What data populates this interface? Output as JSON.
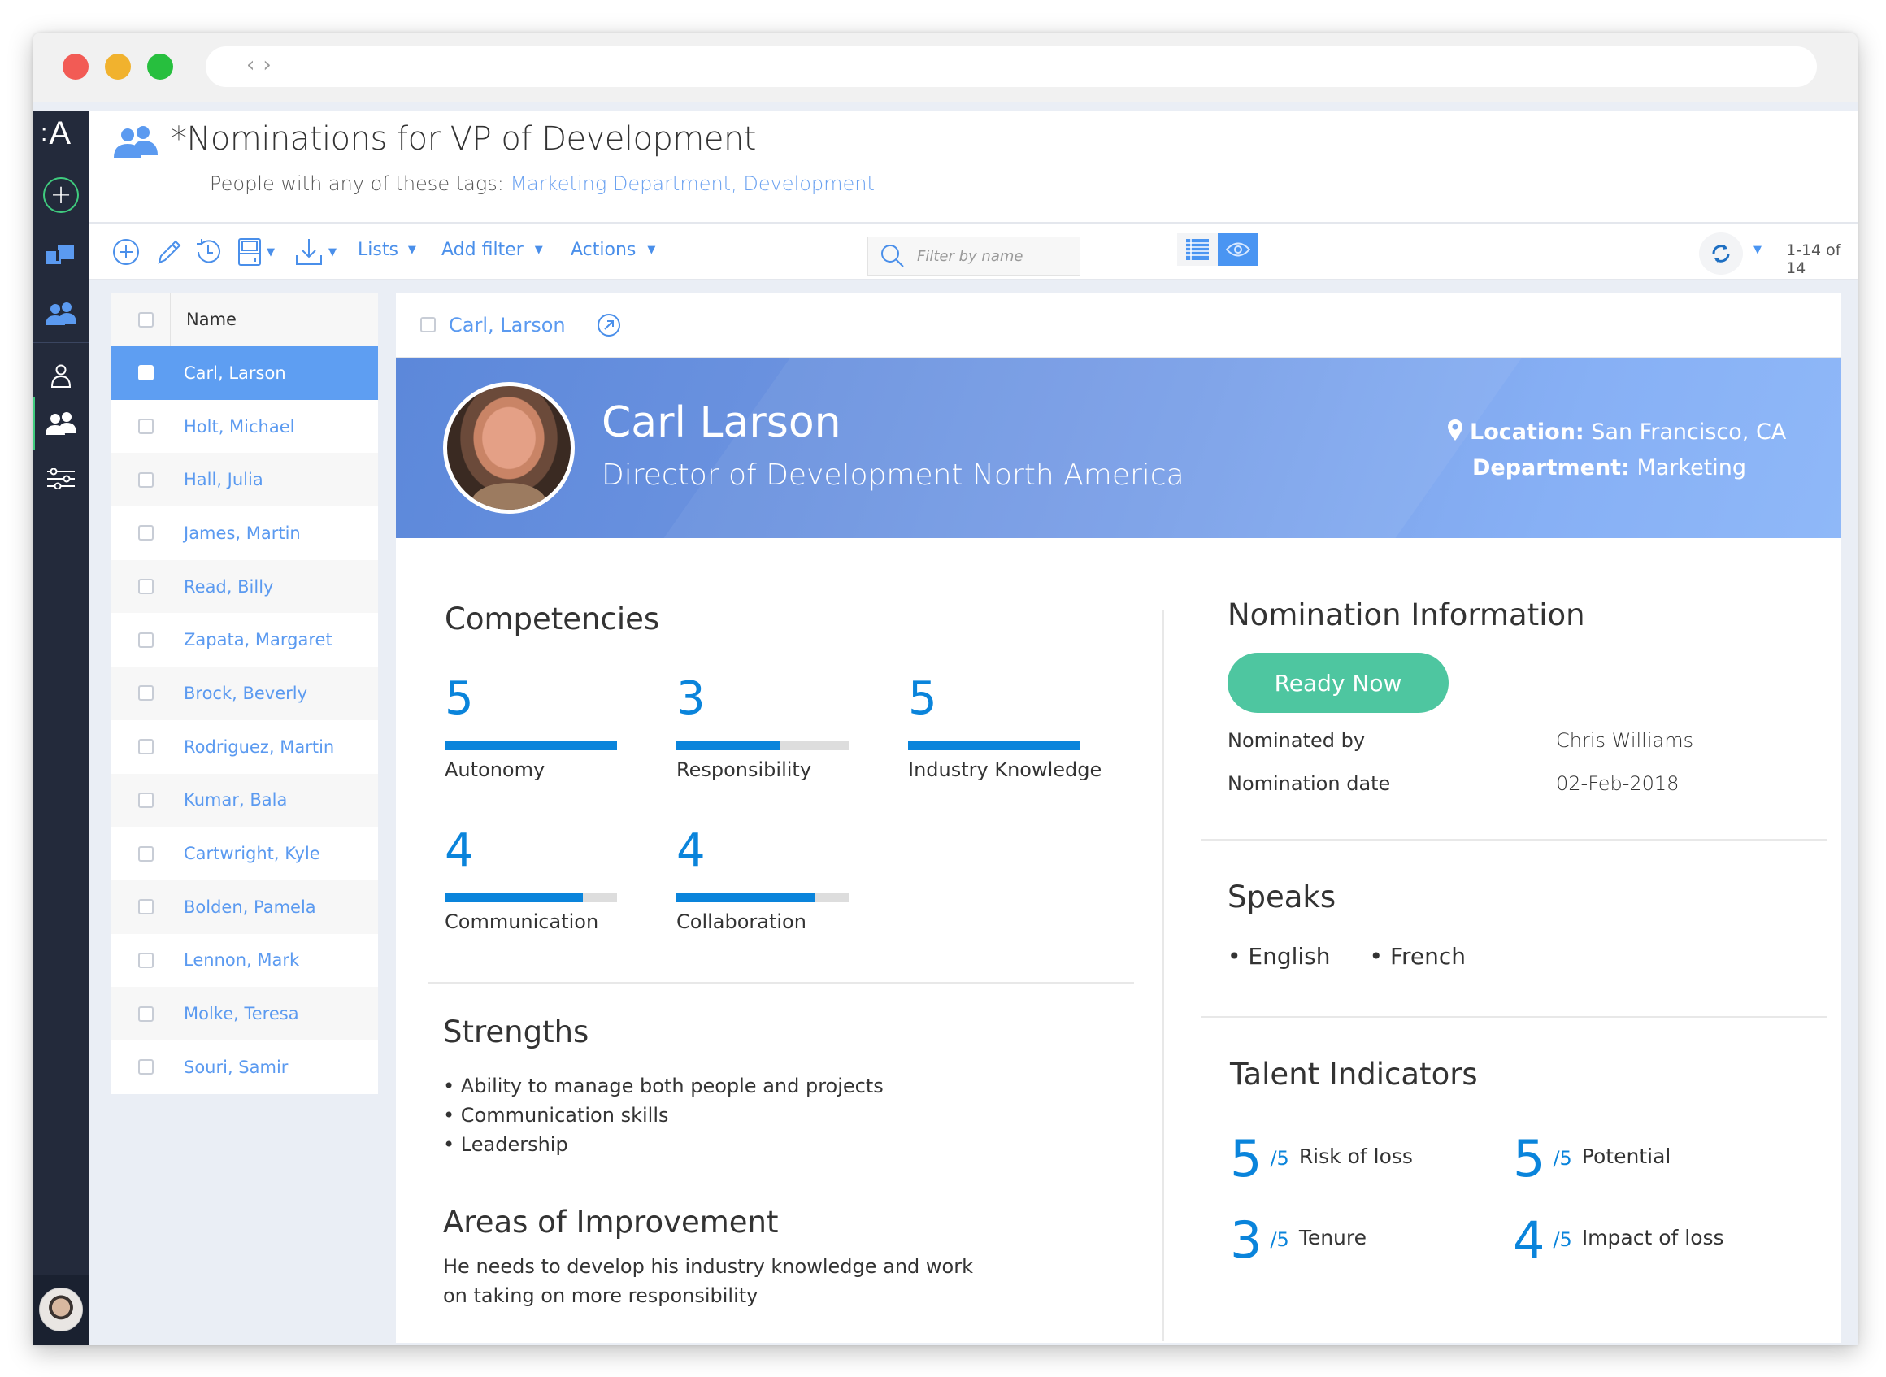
{
  "window": {
    "nav_back": "‹",
    "nav_forward": "›"
  },
  "sidebar": {
    "logo": "A",
    "logo_prefix": ":",
    "items": [
      {
        "name": "add",
        "icon": "plus-circle-icon"
      },
      {
        "name": "folders",
        "icon": "folders-icon"
      },
      {
        "name": "groups",
        "icon": "people-icon"
      },
      {
        "name": "person",
        "icon": "person-icon"
      },
      {
        "name": "team",
        "icon": "people-icon",
        "active": true
      },
      {
        "name": "settings",
        "icon": "sliders-icon"
      }
    ]
  },
  "header": {
    "title": "*Nominations for VP of Development",
    "subtitle_prefix": "People with any of these tags: ",
    "tags": "Marketing Department, Development"
  },
  "toolbar": {
    "lists_label": "Lists",
    "add_filter_label": "Add filter",
    "actions_label": "Actions",
    "filter_placeholder": "Filter by name",
    "filter_value": "",
    "pager": "1-14 of 14",
    "view_mode": "card"
  },
  "list": {
    "column_header": "Name",
    "selected_index": 0,
    "rows": [
      "Carl, Larson",
      "Holt, Michael",
      "Hall, Julia",
      "James, Martin",
      "Read, Billy",
      "Zapata, Margaret",
      "Brock, Beverly",
      "Rodriguez, Martin",
      "Kumar, Bala",
      "Cartwright, Kyle",
      "Bolden, Pamela",
      "Lennon, Mark",
      "Molke, Teresa",
      "Souri, Samir"
    ]
  },
  "detail": {
    "record_link": "Carl, Larson",
    "name": "Carl Larson",
    "job_title": "Director of Development North America",
    "location_label": "Location:",
    "location_value": " San Francisco, CA",
    "department_label": "Department:",
    "department_value": " Marketing",
    "competencies_title": "Competencies",
    "competency_max": 5,
    "competencies": [
      {
        "label": "Autonomy",
        "value": 5
      },
      {
        "label": "Responsibility",
        "value": 3
      },
      {
        "label": "Industry Knowledge",
        "value": 5
      },
      {
        "label": "Communication",
        "value": 4
      },
      {
        "label": "Collaboration",
        "value": 4
      }
    ],
    "strengths_title": "Strengths",
    "strengths": [
      "• Ability to manage both people and projects",
      "• Communication skills",
      "• Leadership"
    ],
    "improvement_title": "Areas of Improvement",
    "improvement_text_line1": "He needs to develop his industry knowledge and work",
    "improvement_text_line2": "on taking on more responsibility",
    "nomination_title": "Nomination Information",
    "status_label": "Ready Now",
    "status_color": "#4EC6A0",
    "nominated_by_label": "Nominated by",
    "nominated_by_value": "Chris Williams",
    "nomination_date_label": "Nomination date",
    "nomination_date_value": "02-Feb-2018",
    "speaks_title": "Speaks",
    "languages": [
      "• English",
      "• French"
    ],
    "talent_title": "Talent Indicators",
    "talent": [
      {
        "value": "5",
        "max": "/5",
        "label": "Risk of loss"
      },
      {
        "value": "5",
        "max": "/5",
        "label": "Potential"
      },
      {
        "value": "3",
        "max": "/5",
        "label": "Tenure"
      },
      {
        "value": "4",
        "max": "/5",
        "label": "Impact of loss"
      }
    ]
  },
  "colors": {
    "accent": "#4A95F2",
    "link": "#5B9AF0",
    "score_blue": "#0A84DB",
    "nav_bg": "#232A3B",
    "ready_green": "#4EC6A0"
  }
}
